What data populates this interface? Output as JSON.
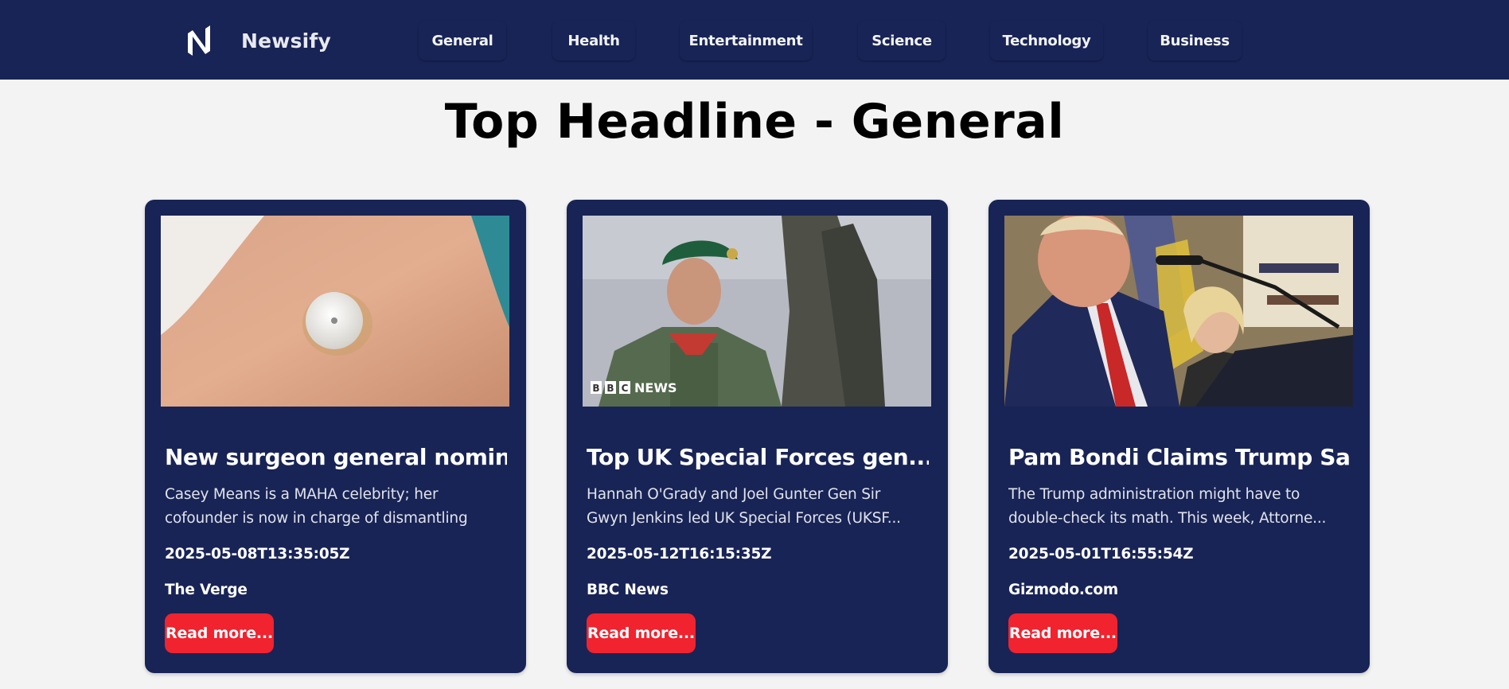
{
  "app": {
    "name": "Newsify"
  },
  "nav": {
    "items": [
      {
        "label": "General"
      },
      {
        "label": "Health"
      },
      {
        "label": "Entertainment"
      },
      {
        "label": "Science"
      },
      {
        "label": "Technology"
      },
      {
        "label": "Business"
      }
    ]
  },
  "page": {
    "title": "Top Headline - General"
  },
  "articles": [
    {
      "title": "New surgeon general nomin...",
      "description": "Casey Means is a MAHA celebrity; her cofounder is now in charge of dismantling t...",
      "published": "2025-05-08T13:35:05Z",
      "source": "The Verge",
      "read_more": "Read more..."
    },
    {
      "title": "Top UK Special Forces gen...",
      "description": "Hannah O'Grady and Joel Gunter Gen Sir Gwyn Jenkins led UK Special Forces (UKSF...",
      "published": "2025-05-12T16:15:35Z",
      "source": "BBC News",
      "read_more": "Read more...",
      "image_watermark": "NEWS"
    },
    {
      "title": "Pam Bondi Claims Trump Sa...",
      "description": "The Trump administration might have to double-check its math. This week, Attorne...",
      "published": "2025-05-01T16:55:54Z",
      "source": "Gizmodo.com",
      "read_more": "Read more..."
    }
  ],
  "colors": {
    "navbar": "#182456",
    "card": "#182456",
    "button": "#f0232e",
    "page_bg": "#f3f3f4"
  }
}
